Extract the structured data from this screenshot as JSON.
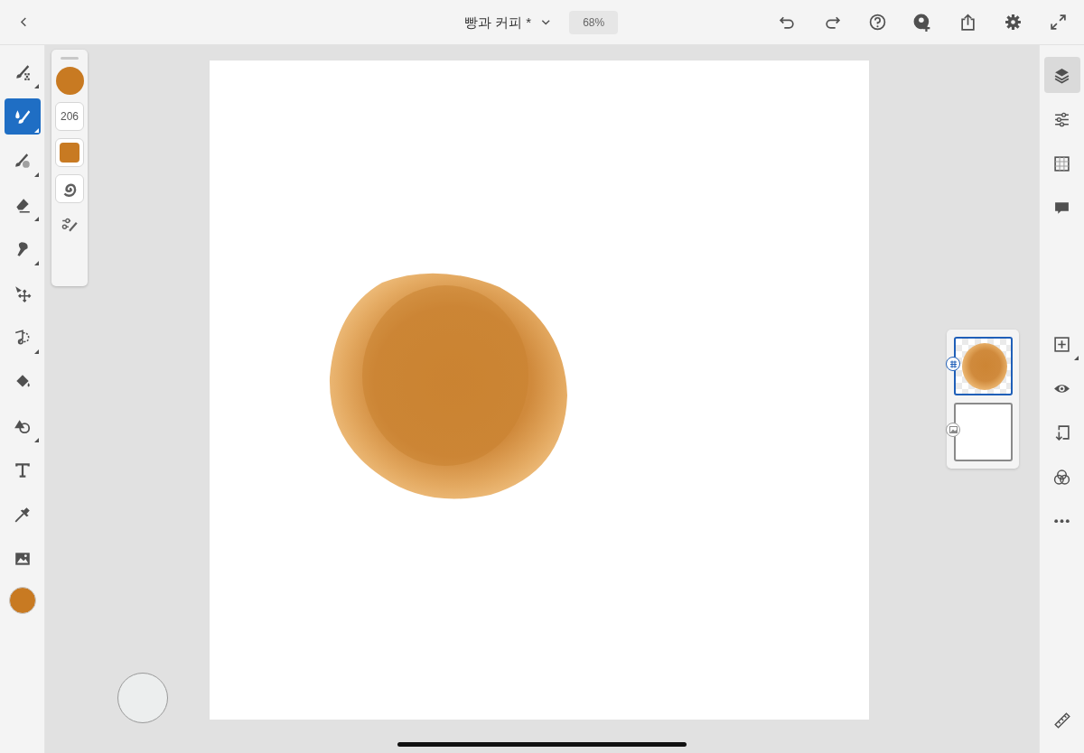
{
  "document": {
    "title": "빵과 커피 *",
    "zoom": "68%"
  },
  "tools": [
    {
      "kind": "pixel-brush",
      "selected": false,
      "submenu": true
    },
    {
      "kind": "live-brush",
      "selected": true,
      "submenu": true
    },
    {
      "kind": "vector-brush",
      "selected": false,
      "submenu": true
    },
    {
      "kind": "eraser",
      "selected": false,
      "submenu": true
    },
    {
      "kind": "smudge",
      "selected": false,
      "submenu": true
    },
    {
      "kind": "transform",
      "selected": false,
      "submenu": false
    },
    {
      "kind": "selection",
      "selected": false,
      "submenu": true
    },
    {
      "kind": "fill",
      "selected": false,
      "submenu": false
    },
    {
      "kind": "shape",
      "selected": false,
      "submenu": true
    },
    {
      "kind": "text",
      "selected": false,
      "submenu": false
    },
    {
      "kind": "eyedropper",
      "selected": false,
      "submenu": false
    },
    {
      "kind": "image",
      "selected": false,
      "submenu": false
    }
  ],
  "current_color": {
    "color": "#c87a22"
  },
  "brush_panel": {
    "brush_color": {
      "color": "#c87a22"
    },
    "size": "206",
    "paint_color": {
      "color": "#c87a22"
    }
  },
  "right_rail_top": [
    {
      "kind": "layers",
      "selected": true,
      "submenu": false
    },
    {
      "kind": "adjustments",
      "selected": false,
      "submenu": false
    },
    {
      "kind": "grid",
      "selected": false,
      "submenu": false
    },
    {
      "kind": "comments",
      "selected": false,
      "submenu": false
    }
  ],
  "right_rail_bottom": [
    {
      "kind": "add-layer",
      "selected": false,
      "submenu": true
    },
    {
      "kind": "visibility",
      "selected": false,
      "submenu": false
    },
    {
      "kind": "merge-down",
      "selected": false,
      "submenu": false
    },
    {
      "kind": "blend",
      "selected": false,
      "submenu": false
    },
    {
      "kind": "more",
      "selected": false,
      "submenu": false
    }
  ],
  "layers": [
    {
      "kind": "paint",
      "selected": true
    },
    {
      "kind": "image",
      "selected": false
    }
  ]
}
